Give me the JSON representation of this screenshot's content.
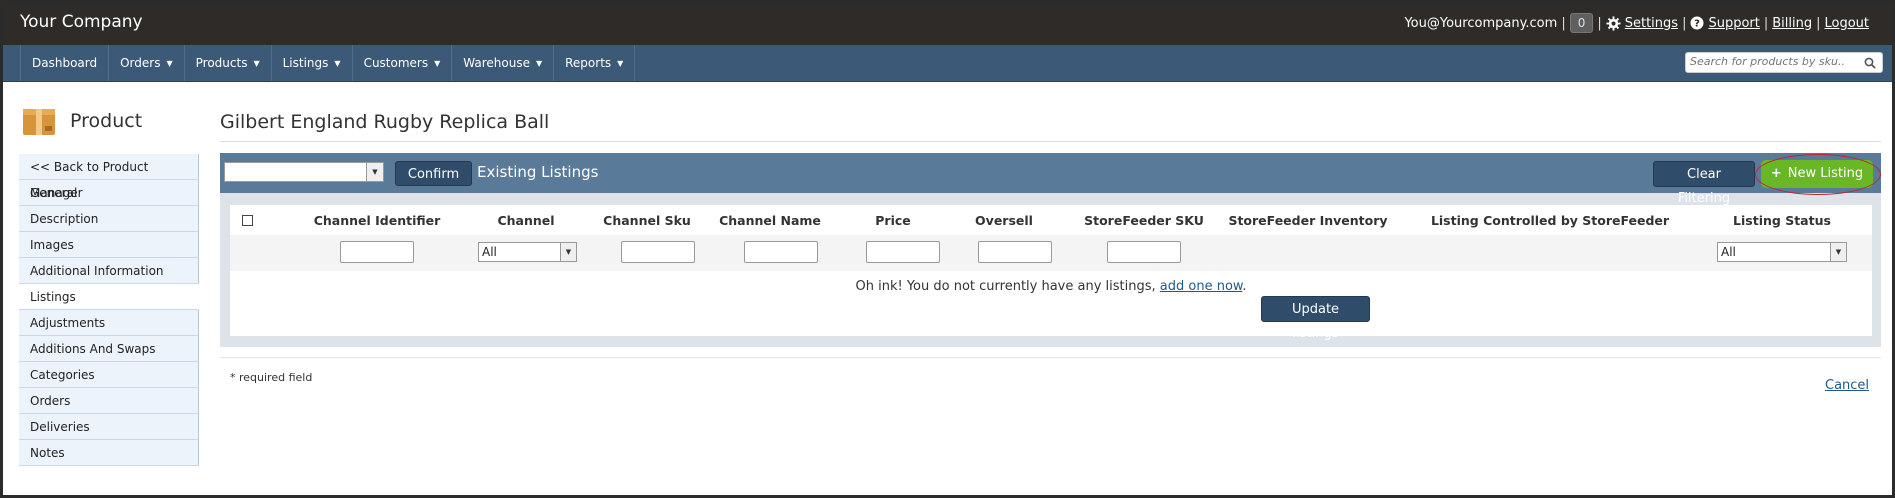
{
  "app": {
    "company": "Your Company",
    "user_email": "You@Yourcompany.com",
    "cart_count": "0",
    "settings_label": "Settings",
    "support_label": "Support",
    "billing_label": "Billing",
    "logout_label": "Logout"
  },
  "nav": {
    "items": [
      {
        "label": "Dashboard",
        "dropdown": false
      },
      {
        "label": "Orders",
        "dropdown": true
      },
      {
        "label": "Products",
        "dropdown": true
      },
      {
        "label": "Listings",
        "dropdown": true
      },
      {
        "label": "Customers",
        "dropdown": true
      },
      {
        "label": "Warehouse",
        "dropdown": true
      },
      {
        "label": "Reports",
        "dropdown": true
      }
    ],
    "search_placeholder": "Search for products by sku.."
  },
  "sidebar": {
    "title": "Product",
    "items": [
      {
        "label": "<< Back to Product Manager"
      },
      {
        "label": "General"
      },
      {
        "label": "Description"
      },
      {
        "label": "Images"
      },
      {
        "label": "Additional Information"
      },
      {
        "label": "Listings",
        "active": true
      },
      {
        "label": "Adjustments"
      },
      {
        "label": "Additions And Swaps"
      },
      {
        "label": "Categories"
      },
      {
        "label": "Orders"
      },
      {
        "label": "Deliveries"
      },
      {
        "label": "Notes"
      }
    ]
  },
  "main": {
    "title": "Gilbert England Rugby Replica Ball",
    "toolbar": {
      "select_value": "",
      "confirm_label": "Confirm",
      "section_title": "Existing Listings",
      "clear_label": "Clear Filtering",
      "new_listing_label": "New Listing"
    },
    "table": {
      "columns": [
        "Channel Identifier",
        "Channel",
        "Channel Sku",
        "Channel Name",
        "Price",
        "Oversell",
        "StoreFeeder SKU",
        "StoreFeeder Inventory",
        "Listing Controlled by StoreFeeder",
        "Listing Status"
      ],
      "channel_filter": "All",
      "status_filter": "All",
      "empty_text": "Oh ink! You do not currently have any listings,",
      "empty_link": "add one now",
      "empty_suffix": ".",
      "update_label": "Update listings"
    },
    "required_note": "* required field",
    "cancel_label": "Cancel"
  },
  "colors": {
    "topbar": "#2e2b28",
    "nav": "#3c5a78",
    "toolbar": "#5a7a99",
    "button_dark": "#2f4d6a",
    "new_listing": "#69b726",
    "highlight": "#c0252c"
  }
}
